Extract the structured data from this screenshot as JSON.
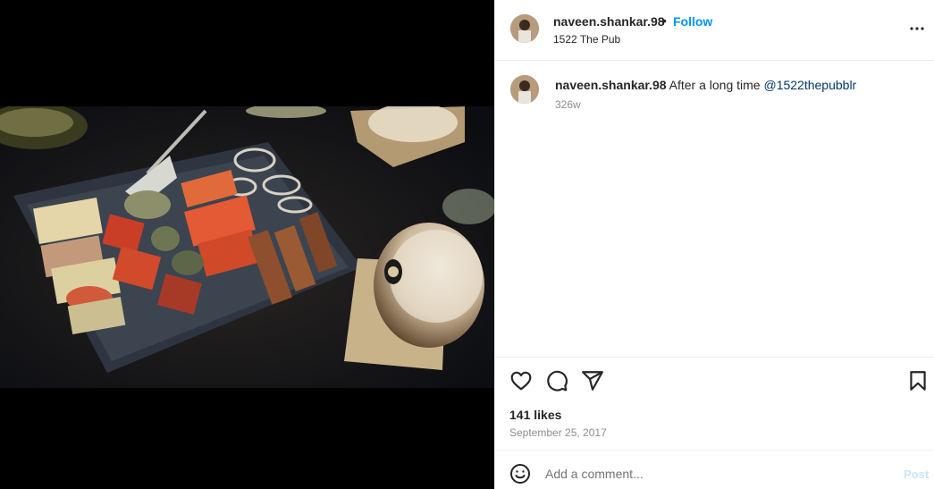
{
  "post": {
    "username": "naveen.shankar.98",
    "separator": "•",
    "follow_label": "Follow",
    "location": "1522 The Pub",
    "more_icon": "more-horizontal-icon"
  },
  "caption": {
    "username": "naveen.shankar.98",
    "text": " After a long time ",
    "mention": "@1522thepubblr",
    "time": "326w"
  },
  "actions": {
    "like_icon": "heart-icon",
    "comment_icon": "comment-icon",
    "share_icon": "send-icon",
    "save_icon": "bookmark-icon"
  },
  "stats": {
    "likes": "141 likes",
    "date": "September 25, 2017"
  },
  "comment_bar": {
    "emoji_icon": "emoji-icon",
    "placeholder": "Add a comment...",
    "post_label": "Post"
  },
  "colors": {
    "accent": "#0095f6",
    "mention": "#00376b",
    "muted": "#8e8e8e",
    "post_disabled": "#c7e6fc"
  }
}
